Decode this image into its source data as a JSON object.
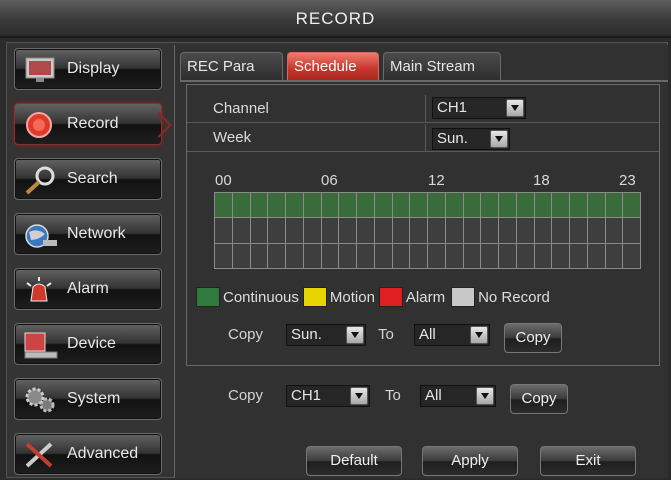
{
  "window": {
    "title": "RECORD"
  },
  "sidebar": {
    "items": [
      {
        "label": "Display",
        "icon": "monitor-icon"
      },
      {
        "label": "Record",
        "icon": "record-icon"
      },
      {
        "label": "Search",
        "icon": "magnifier-icon"
      },
      {
        "label": "Network",
        "icon": "network-globe-icon"
      },
      {
        "label": "Alarm",
        "icon": "alarm-siren-icon"
      },
      {
        "label": "Device",
        "icon": "device-icon"
      },
      {
        "label": "System",
        "icon": "gears-icon"
      },
      {
        "label": "Advanced",
        "icon": "tools-icon"
      }
    ],
    "active": "Record"
  },
  "tabs": [
    {
      "label": "REC Para"
    },
    {
      "label": "Schedule"
    },
    {
      "label": "Main Stream"
    }
  ],
  "schedule": {
    "channel_label": "Channel",
    "channel_value": "CH1",
    "week_label": "Week",
    "week_value": "Sun.",
    "hour_ticks": [
      "00",
      "06",
      "12",
      "18",
      "23"
    ],
    "grid_rows": [
      "continuous x24",
      "no record x24",
      "no record x24"
    ],
    "legend": [
      {
        "label": "Continuous",
        "color": "#2f7a3c"
      },
      {
        "label": "Motion",
        "color": "#e8d400"
      },
      {
        "label": "Alarm",
        "color": "#e02020"
      },
      {
        "label": "No Record",
        "color": "#c8c8c8"
      }
    ],
    "copy_day": {
      "copy_label": "Copy",
      "from_value": "Sun.",
      "to_label": "To",
      "to_value": "All",
      "button_label": "Copy"
    }
  },
  "copy_channel": {
    "copy_label": "Copy",
    "from_value": "CH1",
    "to_label": "To",
    "to_value": "All",
    "button_label": "Copy"
  },
  "footer": {
    "default_label": "Default",
    "apply_label": "Apply",
    "exit_label": "Exit"
  },
  "colors": {
    "active_tab": "#c6352b",
    "continuous": "#3a6b3a"
  }
}
